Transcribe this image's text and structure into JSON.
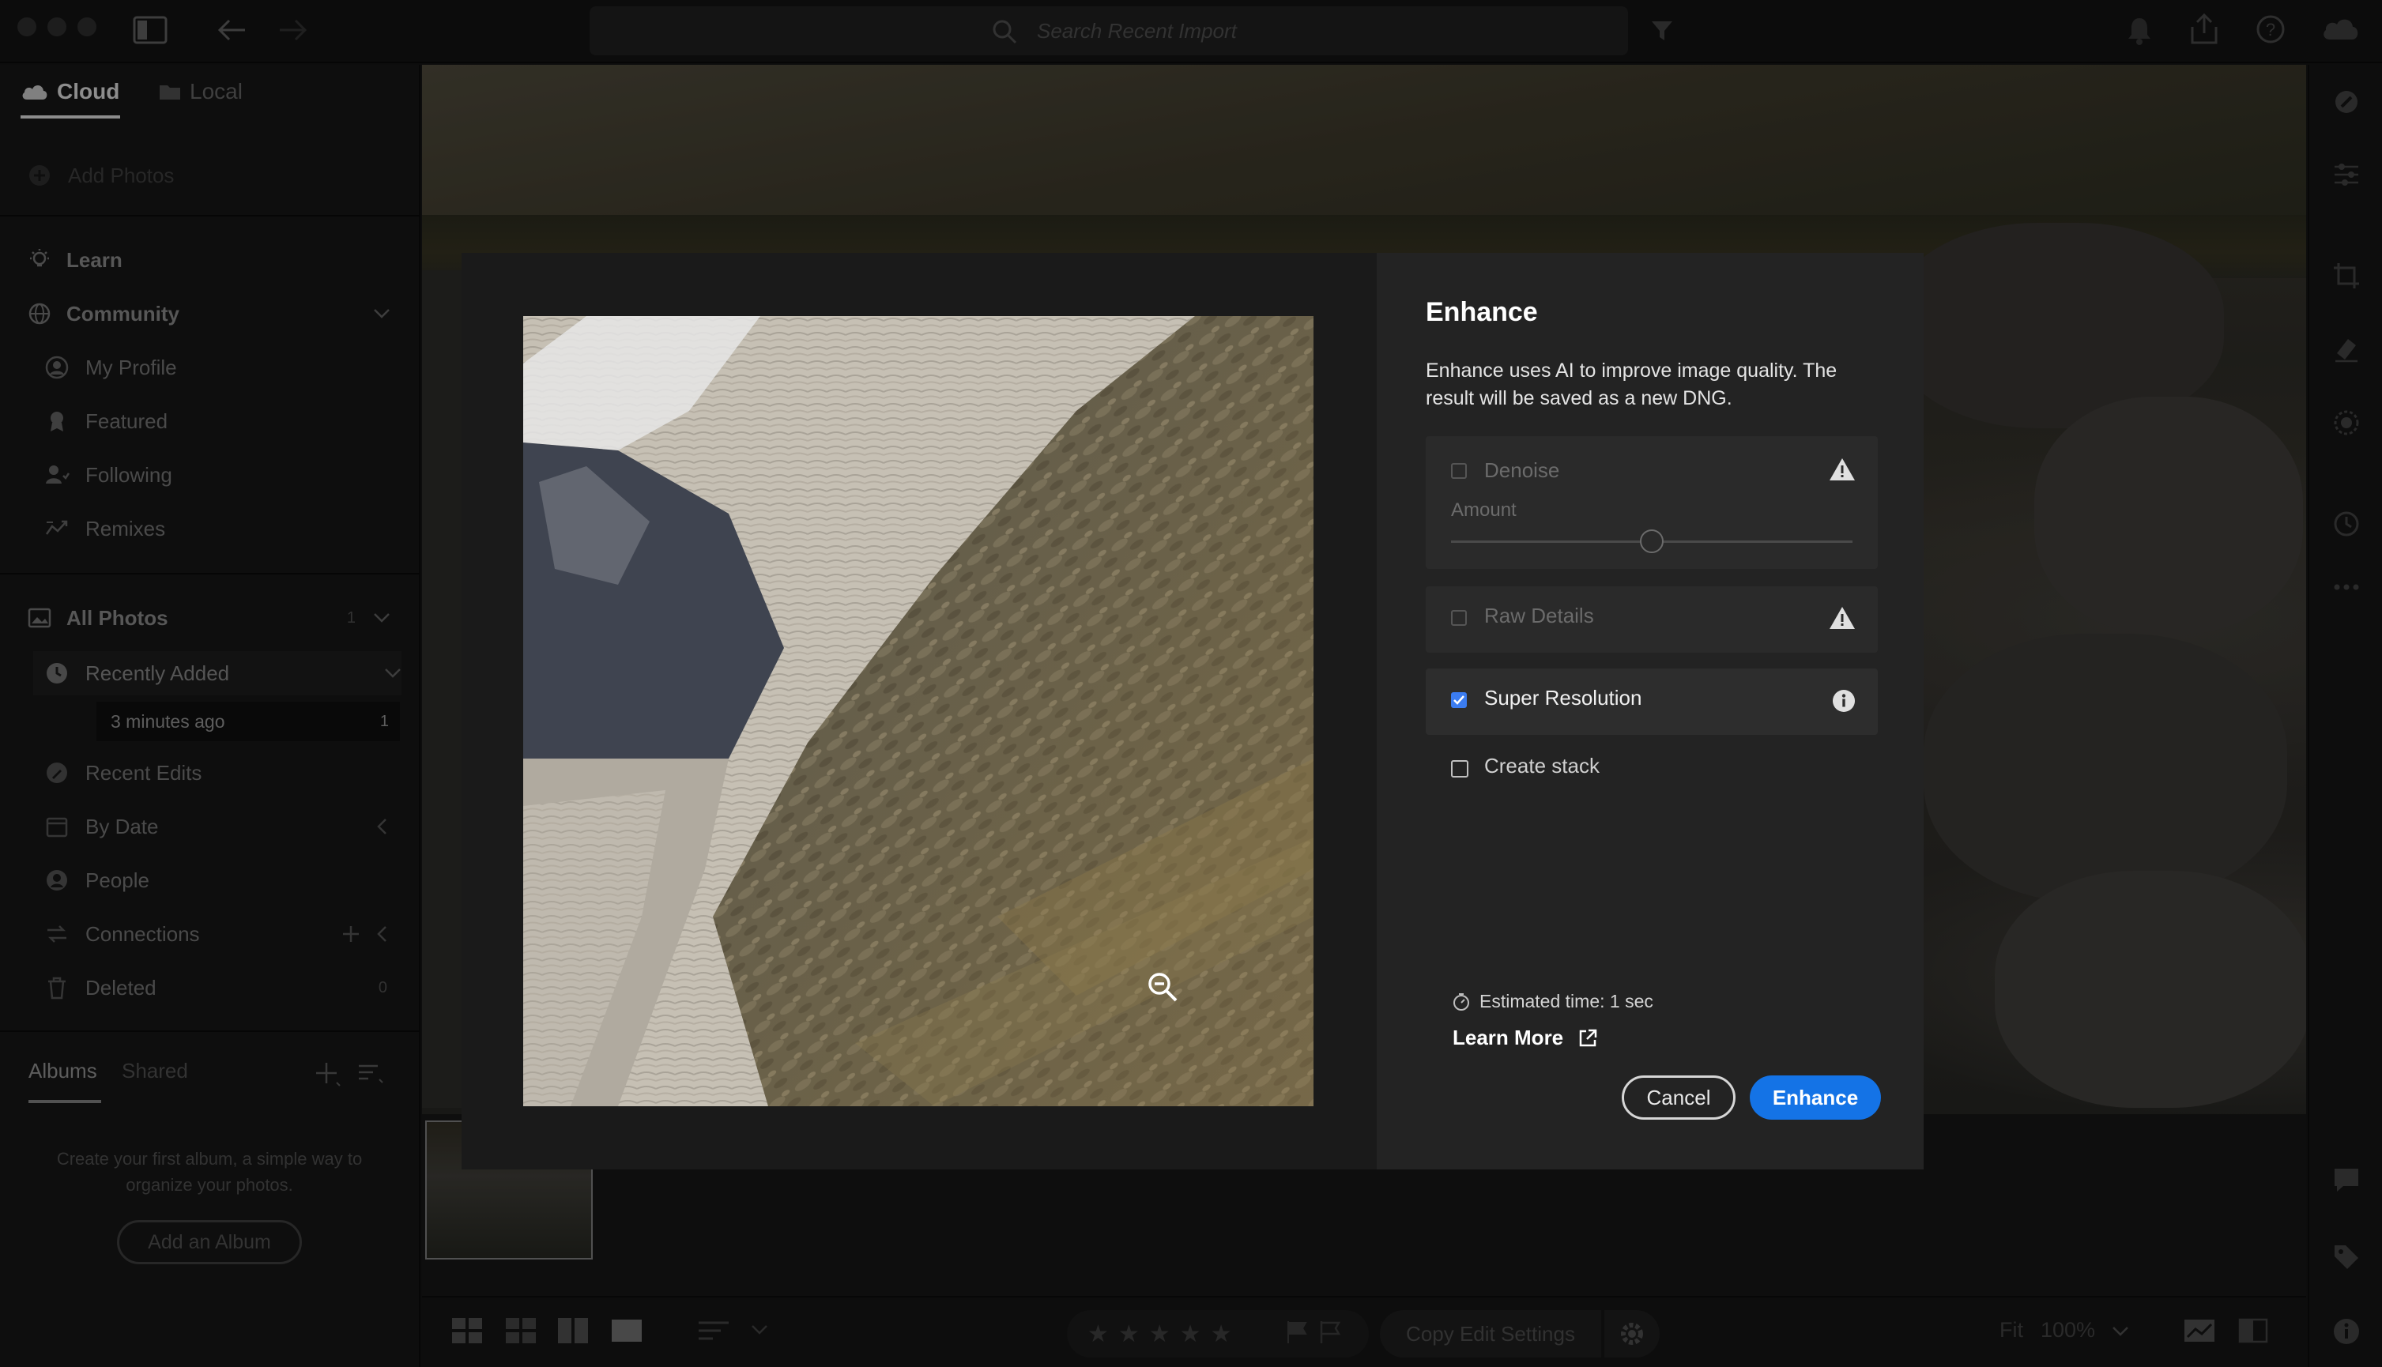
{
  "topbar": {
    "search_placeholder": "Search Recent Import"
  },
  "sidebar": {
    "source_tabs": [
      {
        "label": "Cloud",
        "active": true
      },
      {
        "label": "Local",
        "active": false
      }
    ],
    "add_photos": "Add Photos",
    "learn": "Learn",
    "community": {
      "label": "Community",
      "items": [
        "My Profile",
        "Featured",
        "Following",
        "Remixes"
      ]
    },
    "all_photos": {
      "label": "All Photos",
      "count": "1"
    },
    "recently_added": {
      "label": "Recently Added",
      "sub_label": "3 minutes ago",
      "sub_count": "1"
    },
    "library_items": [
      {
        "label": "Recent Edits"
      },
      {
        "label": "By Date"
      },
      {
        "label": "People"
      },
      {
        "label": "Connections"
      },
      {
        "label": "Deleted",
        "count": "0"
      }
    ],
    "albums_tabs": [
      "Albums",
      "Shared"
    ],
    "albums_empty_text": "Create your first album, a simple way to organize your photos.",
    "add_album_button": "Add an Album"
  },
  "bottombar": {
    "copy_edit_settings": "Copy Edit Settings",
    "fit_label": "Fit",
    "zoom_level": "100%",
    "stars": "★★★★★"
  },
  "dialog": {
    "title": "Enhance",
    "description": "Enhance uses AI to improve image quality. The result will be saved as a new DNG.",
    "options": {
      "denoise": {
        "label": "Denoise",
        "checked": false,
        "enabled": false,
        "amount_label": "Amount",
        "amount_value": 0.5
      },
      "raw_details": {
        "label": "Raw Details",
        "checked": false,
        "enabled": false
      },
      "super_resolution": {
        "label": "Super Resolution",
        "checked": true,
        "enabled": true
      },
      "create_stack": {
        "label": "Create stack",
        "checked": false,
        "enabled": true
      }
    },
    "estimated_time": "Estimated time: 1 sec",
    "learn_more": "Learn More",
    "cancel_button": "Cancel",
    "enhance_button": "Enhance",
    "accent_color": "#1473e6"
  }
}
